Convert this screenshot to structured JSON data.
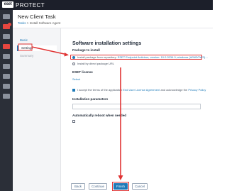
{
  "topbar": {
    "logo": "eset",
    "product": "PROTECT"
  },
  "header": {
    "title": "New Client Task",
    "breadcrumb": [
      "Tasks",
      "Install Software Agent"
    ]
  },
  "steps": [
    {
      "label": "Basic",
      "state": "link"
    },
    {
      "label": "Settings",
      "state": "active"
    },
    {
      "label": "Summary",
      "state": "disabled"
    }
  ],
  "settings": {
    "title": "Software installation settings",
    "package_label": "Package to install",
    "option_repo": "Install package from repository:",
    "option_repo_value": "ESET Endpoint Antivirus; version: 10.0.2034.0; windows (WINDOWS); language: en_US",
    "option_direct": "Install by direct package URL",
    "license_label": "ESET license",
    "license_link": "Select",
    "eula_text": "I accept the terms of the application",
    "eula_link": "End User License Agreement",
    "eula_tail": "and acknowledge the",
    "privacy_link": "Privacy Policy",
    "params_label": "Installation parameters",
    "reboot_label": "Automatically reboot when needed"
  },
  "buttons": {
    "back": "Back",
    "continue": "Continue",
    "finish": "Finish",
    "cancel": "Cancel"
  },
  "colors": {
    "accent": "#1e7ab8",
    "annotation": "#e03333",
    "topbar": "#1c1f2a",
    "rail": "#2b2f38"
  }
}
